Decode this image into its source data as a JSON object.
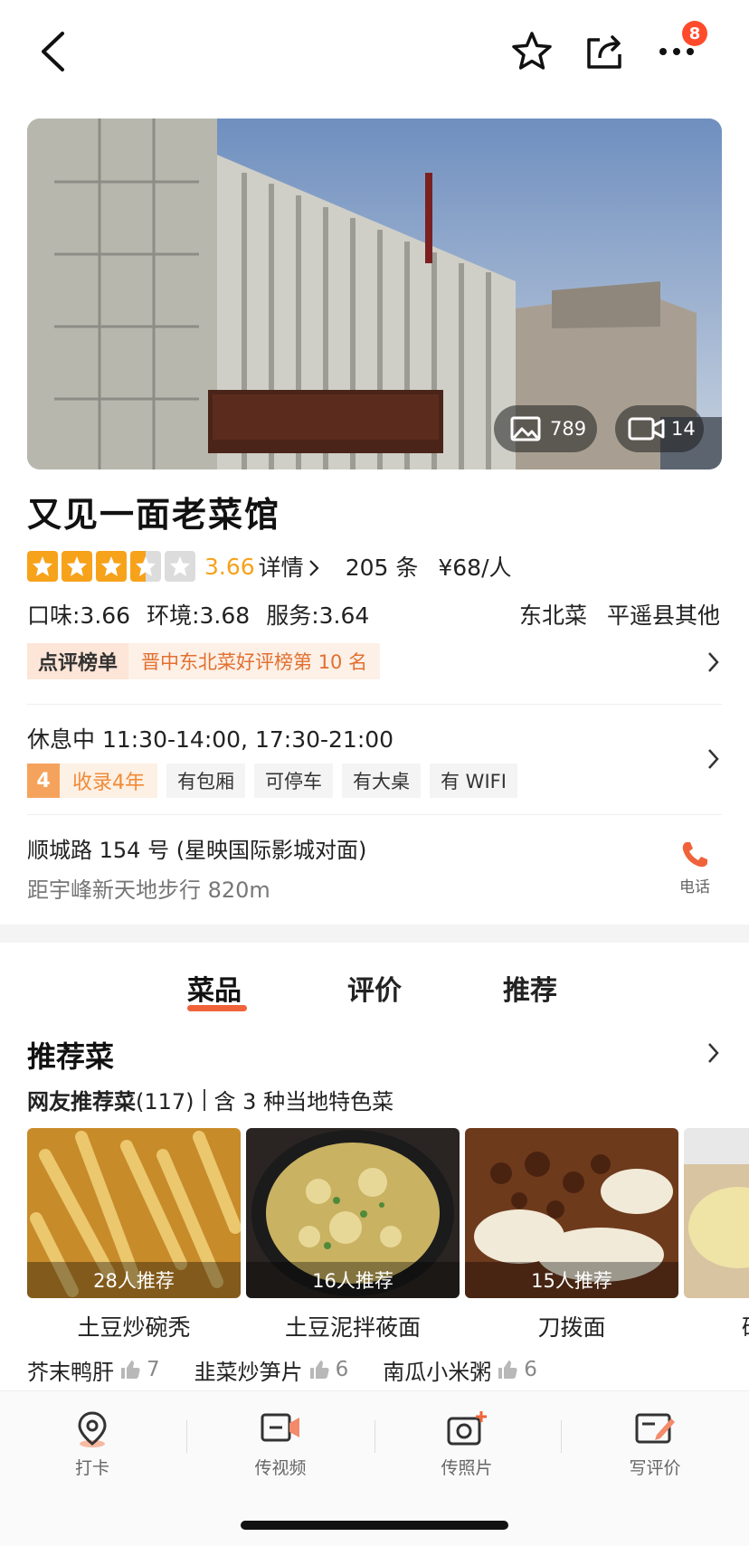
{
  "header": {
    "notification_count": "8"
  },
  "hero": {
    "photo_count": "789",
    "video_count": "14"
  },
  "shop": {
    "name": "又见一面老菜馆",
    "rating": 3.66,
    "rating_text": "3.66",
    "detail_link": "详情",
    "review_count": "205 条",
    "price": "¥68/人",
    "sub_scores": [
      "口味:3.66",
      "环境:3.68",
      "服务:3.64"
    ],
    "cuisine": [
      "东北菜",
      "平遥县其他"
    ],
    "rank_tag": "点评榜单",
    "rank_text": "晋中东北菜好评榜第 10 名"
  },
  "info": {
    "hours": "休息中  11:30-14:00, 17:30-21:00",
    "years_num": "4",
    "years_label": "收录4年",
    "tags": [
      "有包厢",
      "可停车",
      "有大桌",
      "有 WIFI"
    ],
    "address": "顺城路 154 号 (星映国际影城对面)",
    "distance": "距宇峰新天地步行 820m",
    "phone_label": "电话"
  },
  "tabs": [
    "菜品",
    "评价",
    "推荐"
  ],
  "dishes_section": {
    "title": "推荐菜",
    "sub_label": "网友推荐菜",
    "sub_count": "(117)",
    "sub_extra": "含 3 种当地特色菜",
    "dishes": [
      {
        "name": "土豆炒碗秃",
        "count": "28人推荐"
      },
      {
        "name": "土豆泥拌莜面",
        "count": "16人推荐"
      },
      {
        "name": "刀拨面",
        "count": "15人推荐"
      },
      {
        "name": "砂",
        "count": ""
      }
    ],
    "more": [
      {
        "name": "芥末鸭肝",
        "likes": "7"
      },
      {
        "name": "韭菜炒笋片",
        "likes": "6"
      },
      {
        "name": "南瓜小米粥",
        "likes": "6"
      }
    ]
  },
  "bottom_bar": [
    "打卡",
    "传视频",
    "传照片",
    "写评价"
  ],
  "colors": {
    "accent": "#f0633a",
    "star": "#f7a21b",
    "rank_text": "#e2702f"
  }
}
